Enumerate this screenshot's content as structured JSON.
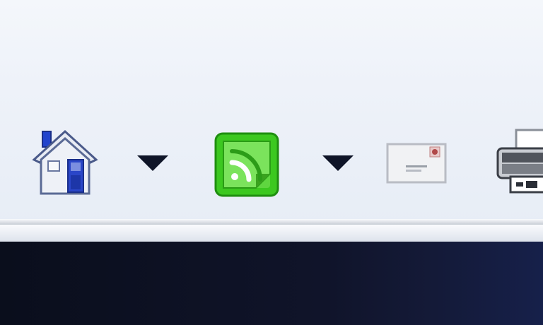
{
  "toolbar": {
    "buttons": [
      {
        "id": "home",
        "icon": "home-icon"
      },
      {
        "id": "home-menu",
        "icon": "dropdown-arrow-icon"
      },
      {
        "id": "feeds",
        "icon": "rss-feed-icon",
        "color": "#3cc820"
      },
      {
        "id": "feeds-menu",
        "icon": "dropdown-arrow-icon"
      },
      {
        "id": "mail",
        "icon": "mail-icon"
      },
      {
        "id": "print",
        "icon": "printer-icon"
      }
    ]
  },
  "colors": {
    "toolbar_bg": "#eef2f8",
    "content_bg": "#0a0e1c",
    "feed_green": "#3cc820",
    "house_blue": "#1f3db8"
  }
}
